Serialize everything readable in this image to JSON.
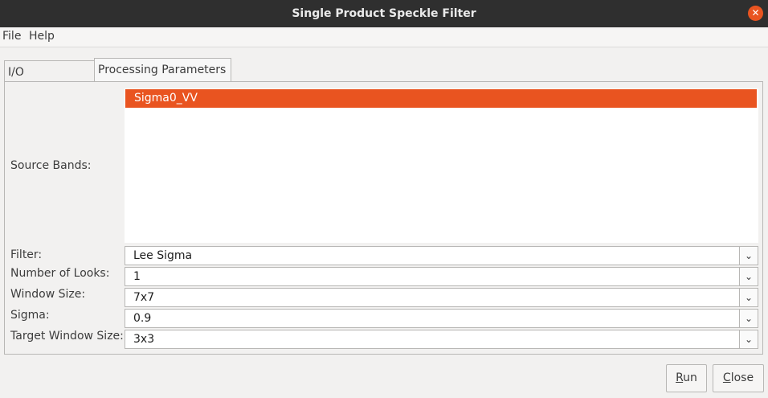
{
  "window": {
    "title": "Single Product Speckle Filter",
    "close_icon": "close-icon"
  },
  "menu": {
    "file": "File",
    "help": "Help"
  },
  "tabs": [
    {
      "label": "I/O Parameters",
      "active": false
    },
    {
      "label": "Processing Parameters",
      "active": true
    }
  ],
  "source_bands": {
    "label": "Source Bands:",
    "items": [
      "Sigma0_VV"
    ],
    "selected": "Sigma0_VV"
  },
  "fields": {
    "filter": {
      "label": "Filter:",
      "value": "Lee Sigma"
    },
    "looks": {
      "label": "Number of Looks:",
      "value": "1"
    },
    "window_size": {
      "label": "Window Size:",
      "value": "7x7"
    },
    "sigma": {
      "label": "Sigma:",
      "value": "0.9"
    },
    "target_window_size": {
      "label": "Target Window Size:",
      "value": "3x3"
    }
  },
  "buttons": {
    "run": "Run",
    "close": "Close"
  },
  "colors": {
    "accent": "#e95420",
    "titlebar": "#2f2f2f",
    "background": "#f2f1f0"
  }
}
